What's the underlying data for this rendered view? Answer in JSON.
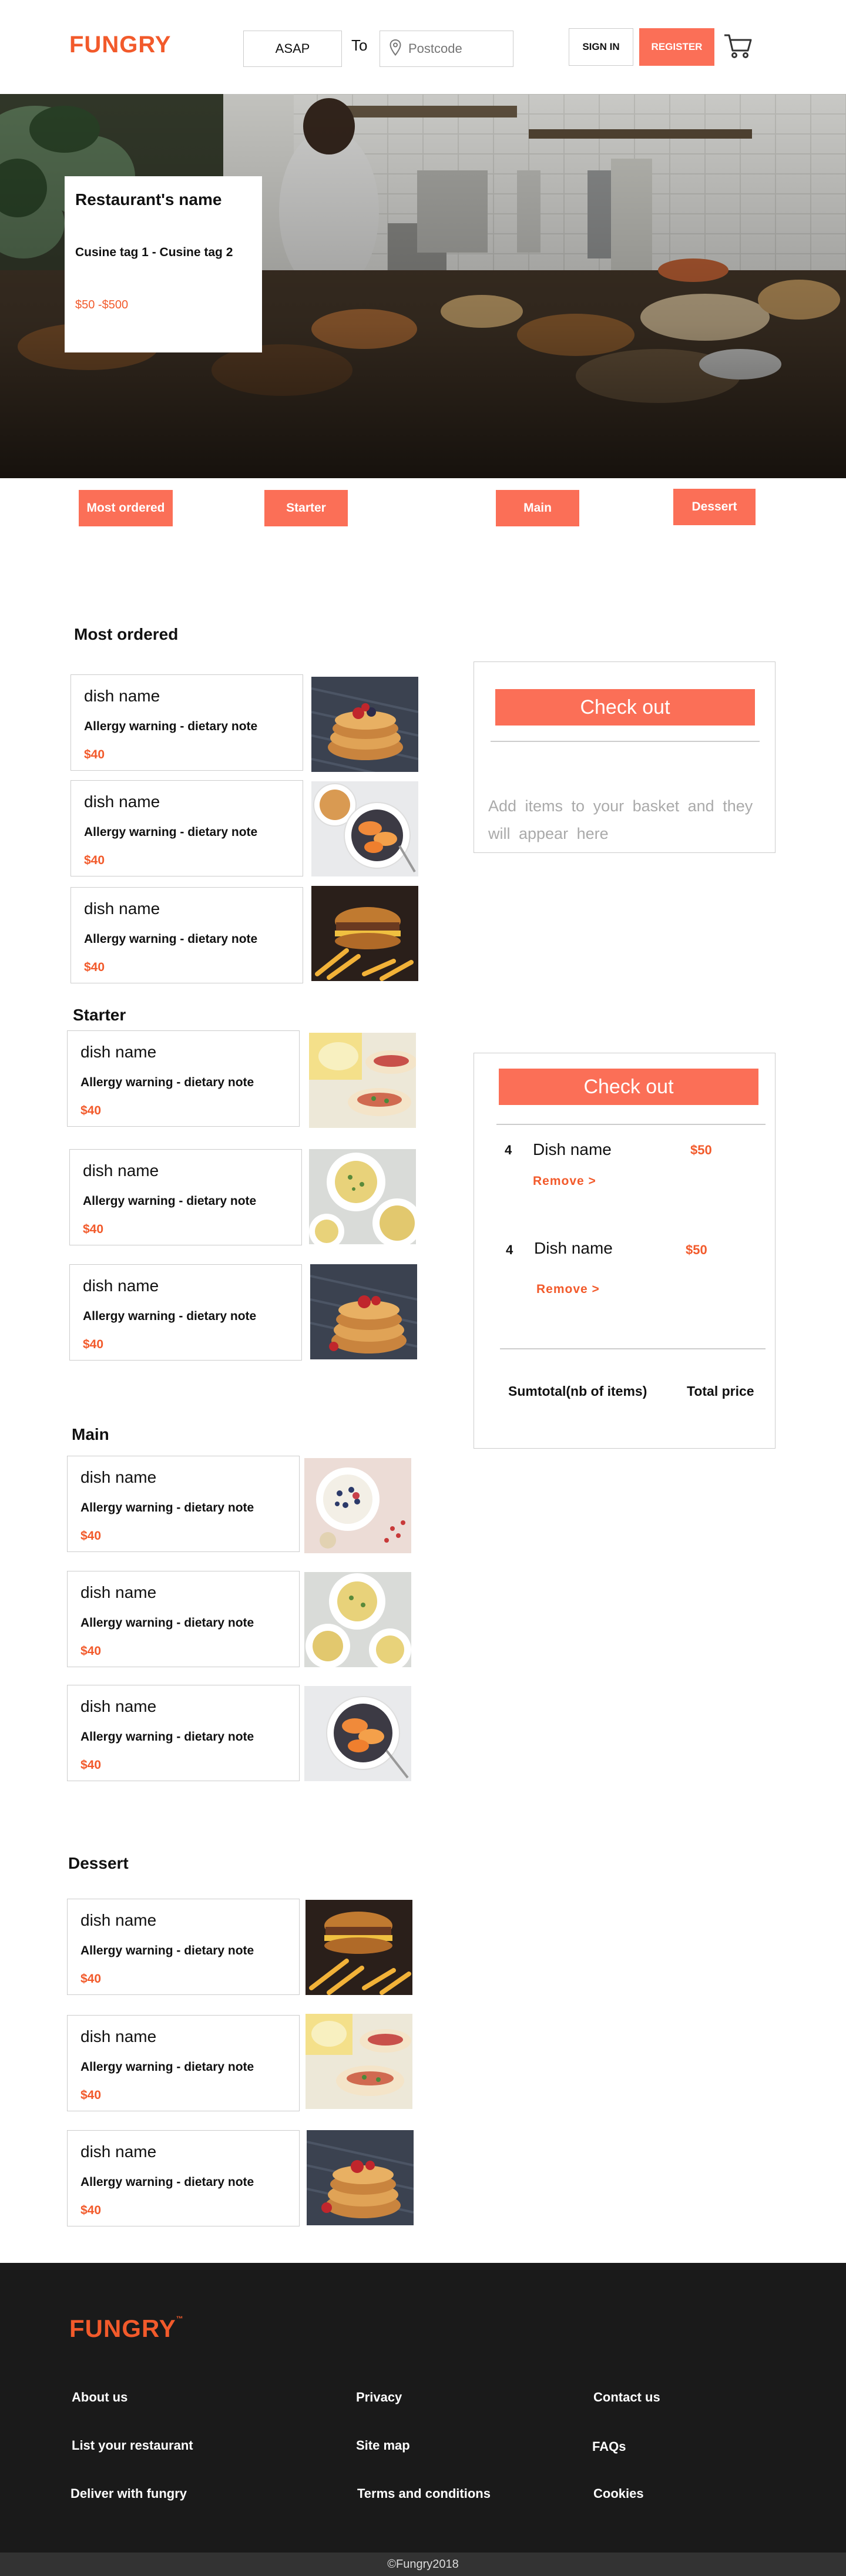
{
  "header": {
    "logo": "FUNGRY",
    "time_select": "ASAP",
    "to_label": "To",
    "postcode_placeholder": "Postcode",
    "signin": "SIGN IN",
    "register": "REGISTER",
    "icons": {
      "location": "location-pin-icon",
      "cart": "cart-icon"
    }
  },
  "hero": {
    "restaurant_name": "Restaurant's  name",
    "tags": "Cusine tag 1 - Cusine tag 2",
    "price_range": "$50 -$500"
  },
  "categories": [
    "Most ordered",
    "Starter",
    "Main",
    "Dessert"
  ],
  "menu": [
    {
      "title": "Most ordered",
      "dishes": [
        {
          "name": "dish name",
          "note": "Allergy warning - dietary note",
          "price": "$40",
          "image": "pancakes"
        },
        {
          "name": "dish name",
          "note": "Allergy warning - dietary note",
          "price": "$40",
          "image": "fruit-bowl"
        },
        {
          "name": "dish name",
          "note": "Allergy warning - dietary note",
          "price": "$40",
          "image": "burger"
        }
      ]
    },
    {
      "title": "Starter",
      "dishes": [
        {
          "name": "dish name",
          "note": "Allergy warning - dietary note",
          "price": "$40",
          "image": "tacos"
        },
        {
          "name": "dish name",
          "note": "Allergy warning - dietary note",
          "price": "$40",
          "image": "pasta"
        },
        {
          "name": "dish name",
          "note": "Allergy warning - dietary note",
          "price": "$40",
          "image": "pancakes"
        }
      ]
    },
    {
      "title": "Main",
      "dishes": [
        {
          "name": "dish name",
          "note": "Allergy warning - dietary note",
          "price": "$40",
          "image": "berry-bowl"
        },
        {
          "name": "dish name",
          "note": "Allergy warning - dietary note",
          "price": "$40",
          "image": "pasta"
        },
        {
          "name": "dish name",
          "note": "Allergy warning - dietary note",
          "price": "$40",
          "image": "fruit-bowl"
        }
      ]
    },
    {
      "title": "Dessert",
      "dishes": [
        {
          "name": "dish name",
          "note": "Allergy warning - dietary note",
          "price": "$40",
          "image": "burger"
        },
        {
          "name": "dish name",
          "note": "Allergy warning - dietary note",
          "price": "$40",
          "image": "tacos"
        },
        {
          "name": "dish name",
          "note": "Allergy warning - dietary note",
          "price": "$40",
          "image": "pancakes"
        }
      ]
    }
  ],
  "basket_empty": {
    "checkout": "Check out",
    "note": "Add items to  your  basket  and they will  appear here"
  },
  "basket_filled": {
    "checkout": "Check out",
    "items": [
      {
        "qty": "4",
        "name": "Dish  name",
        "price": "$50",
        "remove": "Remove   >"
      },
      {
        "qty": "4",
        "name": "Dish  name",
        "price": "$50",
        "remove": "Remove   >"
      }
    ],
    "subtotal": "Sumtotal(nb of items)",
    "total": "Total price"
  },
  "footer": {
    "logo": "FUNGRY",
    "logo_mark": "™",
    "links": [
      "About us",
      "Privacy",
      "Contact us",
      "List your restaurant",
      "Site map",
      "FAQs",
      "Deliver with fungry",
      "Terms and conditions",
      "Cookies"
    ],
    "copyright": "©Fungry2018"
  },
  "colors": {
    "accent": "#fb6f57",
    "brand": "#f25a2b",
    "footer_bg": "#1a1a1a"
  }
}
